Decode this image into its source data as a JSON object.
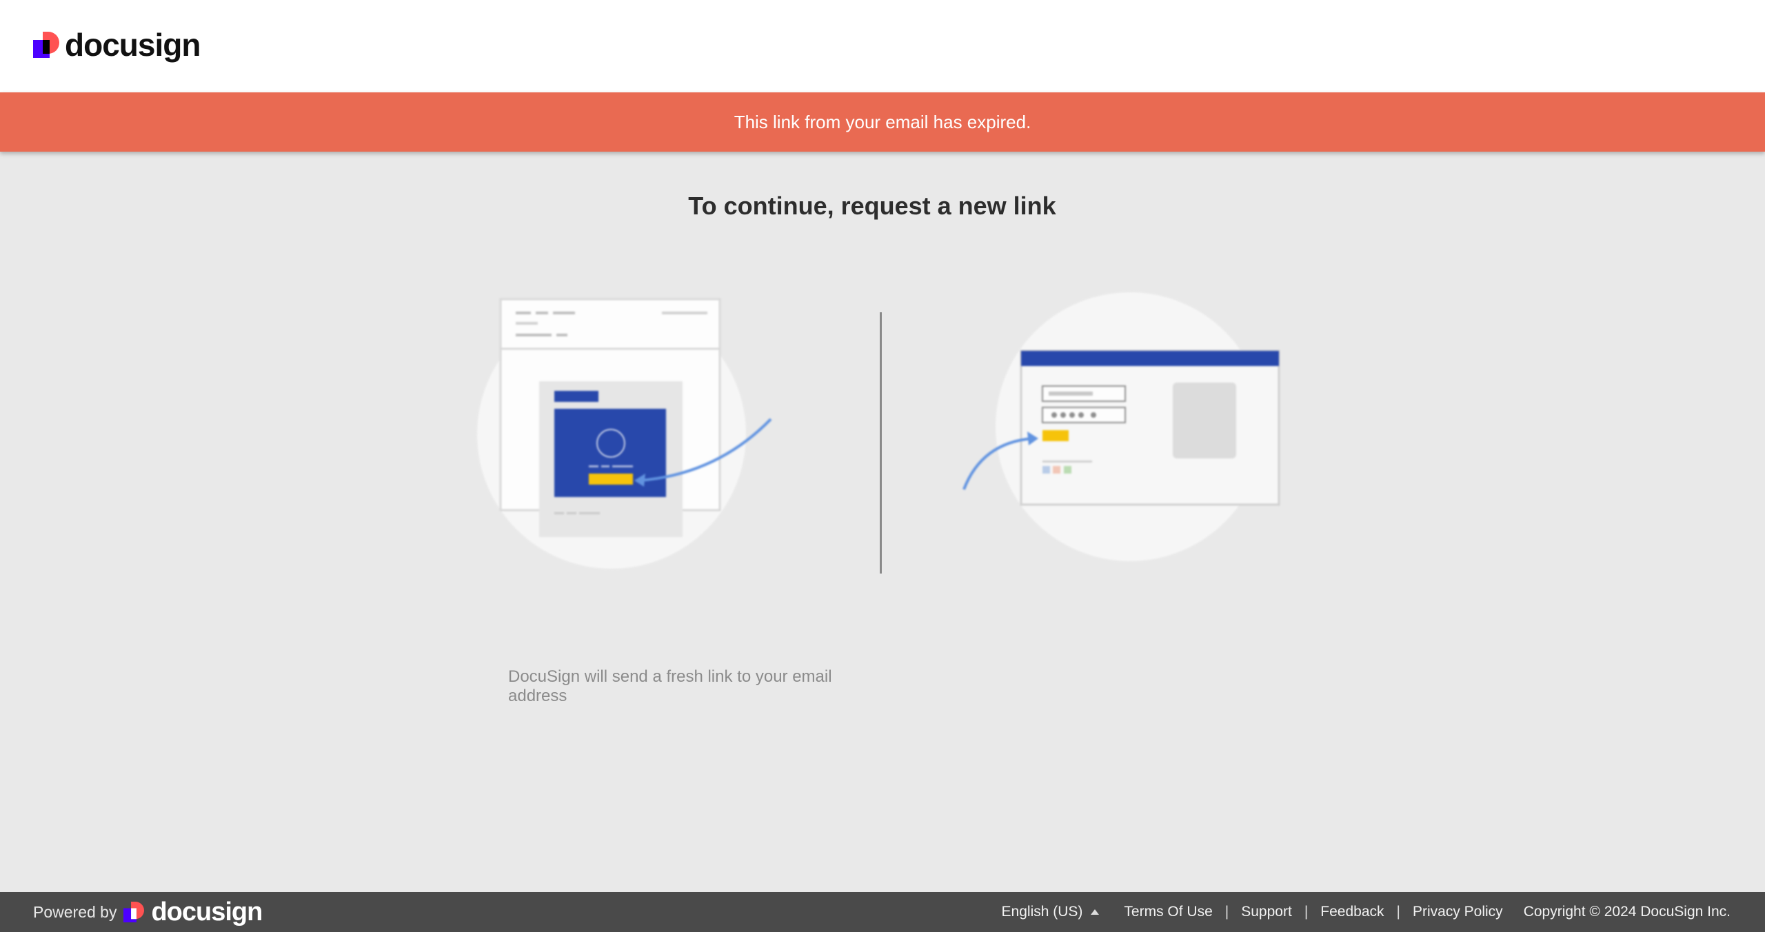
{
  "header": {
    "logo_text": "docusign"
  },
  "banner": {
    "message": "This link from your email has expired."
  },
  "main": {
    "title": "To continue, request a new link",
    "caption": "DocuSign will send a fresh link to your email address"
  },
  "footer": {
    "powered_by": "Powered by",
    "logo_text": "docusign",
    "language": "English (US)",
    "links": [
      "Terms Of Use",
      "Support",
      "Feedback",
      "Privacy Policy"
    ],
    "separator": "|",
    "copyright": "Copyright © 2024 DocuSign Inc."
  },
  "colors": {
    "banner": "#e96a52",
    "brand_red": "#ff5252",
    "brand_purple": "#4c00ff",
    "illustration_blue": "#1e40a8",
    "illustration_yellow": "#f7c200",
    "arrow_blue": "#5a8fe0",
    "footer": "#4a4a4a"
  },
  "icons": {
    "logo_mark": "docusign-logo-mark-icon",
    "language_caret": "caret-up-icon"
  }
}
